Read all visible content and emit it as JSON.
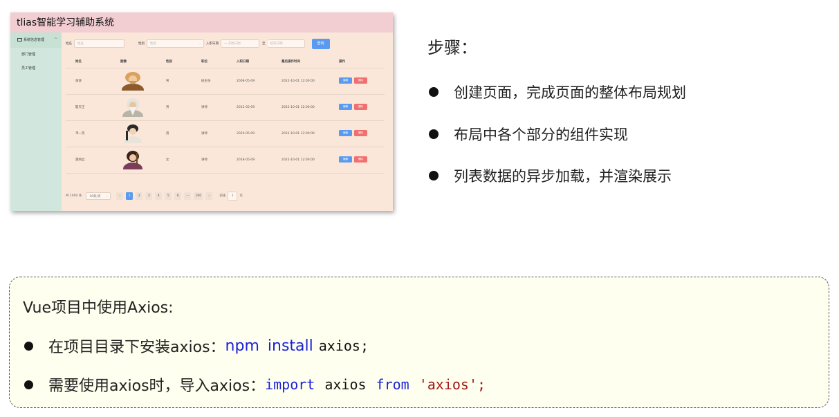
{
  "app": {
    "title": "tlias智能学习辅助系统",
    "sidebar": {
      "group_label": "系统信息管理",
      "items": [
        {
          "label": "部门管理"
        },
        {
          "label": "员工管理"
        }
      ]
    },
    "search": {
      "name_label": "姓名",
      "name_placeholder": "姓名",
      "gender_label": "性别",
      "gender_placeholder": "性别",
      "date_label": "入职日期",
      "start_placeholder": "开始日期",
      "separator": "至",
      "end_placeholder": "结束日期",
      "query_button": "查询"
    },
    "table": {
      "headers": [
        "姓名",
        "图像",
        "性别",
        "职位",
        "入职日期",
        "最后操作时间",
        "操作"
      ],
      "rows": [
        {
          "name": "谢逊",
          "gender": "男",
          "job": "班主任",
          "entry": "2008-05-09",
          "updated": "2022-10-01 12:00:00"
        },
        {
          "name": "殷天正",
          "gender": "男",
          "job": "讲师",
          "entry": "2012-05-09",
          "updated": "2022-10-01 12:00:00"
        },
        {
          "name": "韦一笑",
          "gender": "男",
          "job": "讲师",
          "entry": "2020-05-09",
          "updated": "2022-10-01 12:00:00"
        },
        {
          "name": "黛绮丝",
          "gender": "女",
          "job": "讲师",
          "entry": "2018-05-09",
          "updated": "2022-10-01 12:00:00"
        }
      ],
      "edit_label": "编辑",
      "delete_label": "删除"
    },
    "pagination": {
      "total": "共 1000 条",
      "page_size": "10条/页",
      "prev": "‹",
      "pages": [
        "1",
        "2",
        "3",
        "4",
        "5",
        "6"
      ],
      "ellipsis": "···",
      "last": "100",
      "next": "›",
      "goto_label": "前往",
      "goto_value": "1",
      "goto_suffix": "页",
      "active_page": 1
    }
  },
  "steps": {
    "title": "步骤：",
    "items": [
      "创建页面，完成页面的整体布局规划",
      "布局中各个部分的组件实现",
      "列表数据的异步加载，并渲染展示"
    ]
  },
  "axios": {
    "title": "Vue项目中使用Axios:",
    "line1": {
      "text": "在项目目录下安装axios：",
      "cmd1": "npm",
      "cmd2": "install",
      "pkg": "axios;"
    },
    "line2": {
      "text": "需要使用axios时，导入axios：",
      "kw_import": "import",
      "ident": "axios",
      "kw_from": "from",
      "str": "'axios';"
    },
    "colors": {
      "keyword": "#1a22d8",
      "string": "#a31515",
      "box_background": "#ffffef",
      "header": "#f2cdd2",
      "sidebar": "#d1e7dd",
      "primary_button": "#5a9bef",
      "danger_button": "#f07070"
    }
  }
}
